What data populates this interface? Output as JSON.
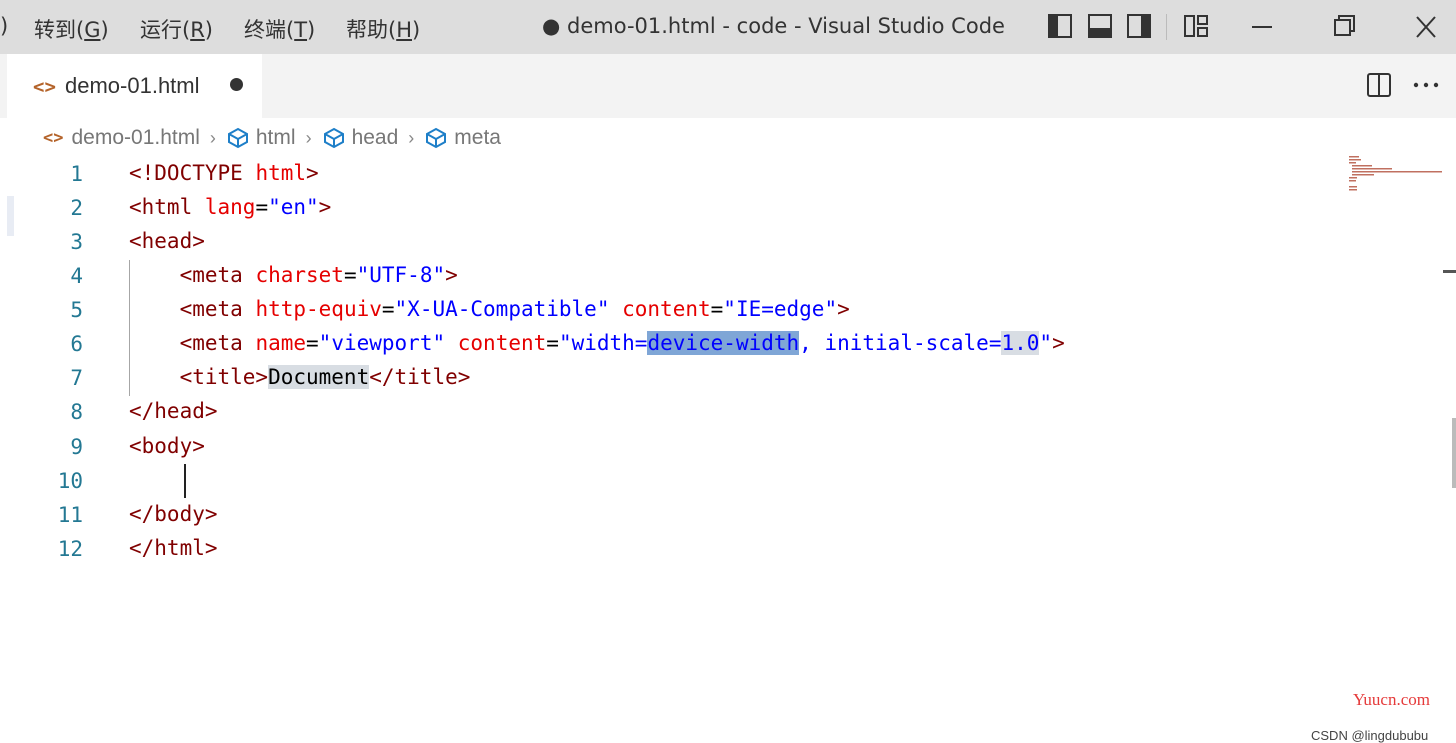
{
  "titlebar": {
    "menu": [
      {
        "label": ")",
        "accel": ""
      },
      {
        "label": "转到(",
        "accel": "G",
        "suffix": ")"
      },
      {
        "label": "运行(",
        "accel": "R",
        "suffix": ")"
      },
      {
        "label": "终端(",
        "accel": "T",
        "suffix": ")"
      },
      {
        "label": "帮助(",
        "accel": "H",
        "suffix": ")"
      }
    ],
    "window_title": "● demo-01.html - code - Visual Studio Code",
    "icons": [
      "toggle-primary-sidebar-icon",
      "toggle-panel-icon",
      "toggle-secondary-sidebar-icon",
      "customize-layout-icon"
    ],
    "window_controls": [
      "minimize-icon",
      "restore-icon",
      "close-icon"
    ]
  },
  "tab": {
    "label": "demo-01.html",
    "icon": "html-file-icon",
    "dirty": true
  },
  "editor_actions": [
    "split-editor-icon",
    "more-actions-icon"
  ],
  "breadcrumb": {
    "file": "demo-01.html",
    "items": [
      "html",
      "head",
      "meta"
    ]
  },
  "lines": [
    {
      "n": "1"
    },
    {
      "n": "2"
    },
    {
      "n": "3"
    },
    {
      "n": "4"
    },
    {
      "n": "5"
    },
    {
      "n": "6"
    },
    {
      "n": "7"
    },
    {
      "n": "8"
    },
    {
      "n": "9"
    },
    {
      "n": "10"
    },
    {
      "n": "11"
    },
    {
      "n": "12"
    }
  ],
  "code": {
    "l1": {
      "a": "<!DOCTYPE ",
      "b": "html",
      "c": ">"
    },
    "l2": {
      "a": "<html ",
      "b": "lang",
      "c": "=",
      "d": "\"en\"",
      "e": ">"
    },
    "l3": {
      "a": "<head>"
    },
    "l4": {
      "a": "    <meta ",
      "b": "charset",
      "c": "=",
      "d": "\"UTF-8\"",
      "e": ">"
    },
    "l5": {
      "a": "    <meta ",
      "b": "http-equiv",
      "c": "=",
      "d": "\"X-UA-Compatible\"",
      "e": " ",
      "f": "content",
      "g": "=",
      "h": "\"IE=edge\"",
      "i": ">"
    },
    "l6": {
      "a": "    <meta ",
      "b": "name",
      "c": "=",
      "d": "\"viewport\"",
      "e": " ",
      "f": "content",
      "g": "=",
      "h1": "\"width=",
      "h2": "device-width",
      "h3": ", initial-scale=",
      "h4": "1.0",
      "h5": "\"",
      "i": ">"
    },
    "l7": {
      "a": "    <title>",
      "b": "Document",
      "c": "</title>"
    },
    "l8": {
      "a": "</head>"
    },
    "l9": {
      "a": "<body>"
    },
    "l10": {
      "a": ""
    },
    "l11": {
      "a": "</body>"
    },
    "l12": {
      "a": "</html>"
    }
  },
  "colors": {
    "tag": "#800000",
    "attribute": "#e50000",
    "value": "#0000ff",
    "line_number": "#237893",
    "selection": "#7fa6d6"
  },
  "watermark": {
    "site": "Yuucn.com",
    "credit": "CSDN @lingdububu"
  }
}
